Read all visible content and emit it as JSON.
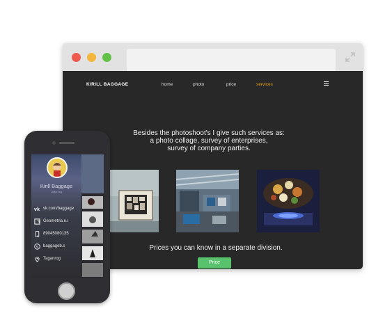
{
  "site": {
    "logo": "KIRILL BAGGAGE",
    "nav": [
      {
        "label": "home",
        "active": false
      },
      {
        "label": "photo",
        "active": false
      },
      {
        "label": "price",
        "active": false
      },
      {
        "label": "services",
        "active": true
      }
    ],
    "intro_lines": [
      "Besides  the photoshoot's I give such services as:",
      "a photo collage, survey of enterprises,",
      "survey of company parties."
    ],
    "photos": [
      "photo-collage-image",
      "enterprise-survey-image",
      "corporate-party-image"
    ],
    "prices_note": "Prices you can know in a separate division.",
    "price_button": "Price",
    "pagination": {
      "count": 3,
      "active_index": 2
    }
  },
  "phone": {
    "profile_name": "Kirill Baggage",
    "profile_sub": "Taganrog",
    "contacts": [
      {
        "icon": "vk-icon",
        "text": "vk.com/baggage"
      },
      {
        "icon": "geometria-icon",
        "text": "Geometria.ru"
      },
      {
        "icon": "phone-icon",
        "text": "89045080135"
      },
      {
        "icon": "skype-icon",
        "text": "baggageb.s"
      },
      {
        "icon": "location-icon",
        "text": "Taganrog"
      }
    ]
  },
  "colors": {
    "site_background": "#282828",
    "active_nav": "#e8a317",
    "price_button": "#58c26c",
    "close_dot": "#ee5b4e",
    "minimize_dot": "#f4b63e",
    "maximize_dot": "#63c148"
  }
}
